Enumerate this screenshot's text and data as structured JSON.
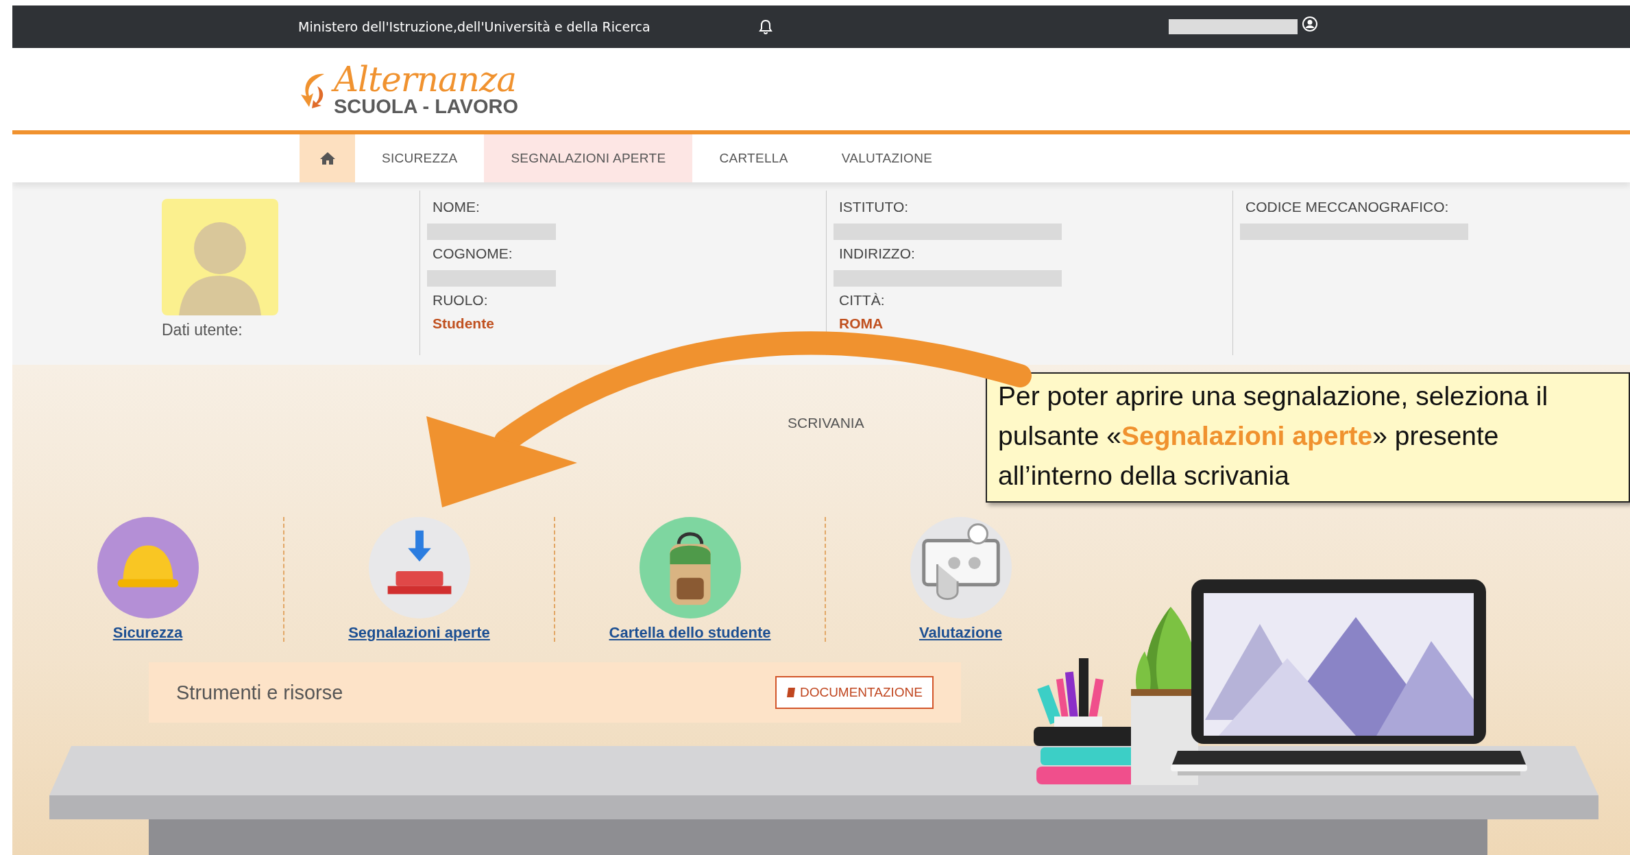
{
  "top_bar": {
    "ministry": "Ministero dell'Istruzione,dell'Università e della Ricerca"
  },
  "logo": {
    "title": "Alternanza",
    "subtitle": "SCUOLA - LAVORO"
  },
  "nav": {
    "tabs": [
      {
        "kind": "home",
        "selected": true,
        "highlighted": false
      },
      {
        "kind": "text",
        "label": "SICUREZZA",
        "selected": false,
        "highlighted": false
      },
      {
        "kind": "text",
        "label": "SEGNALAZIONI APERTE",
        "selected": false,
        "highlighted": true
      },
      {
        "kind": "text",
        "label": "CARTELLA",
        "selected": false,
        "highlighted": false
      },
      {
        "kind": "text",
        "label": "VALUTAZIONE",
        "selected": false,
        "highlighted": false
      }
    ]
  },
  "user_info": {
    "caption": "Dati utente:",
    "columns": [
      [
        {
          "label": "NOME:",
          "redacted": true
        },
        {
          "label": "COGNOME:",
          "redacted": true
        },
        {
          "label": "RUOLO:",
          "redacted": false,
          "value": "Studente"
        }
      ],
      [
        {
          "label": "ISTITUTO:",
          "redacted": true
        },
        {
          "label": "INDIRIZZO:",
          "redacted": true
        },
        {
          "label": "CITTÀ:",
          "redacted": false,
          "value": "ROMA"
        }
      ],
      [
        {
          "label": "CODICE MECCANOGRAFICO:",
          "redacted": true
        }
      ]
    ]
  },
  "desk": {
    "title": "SCRIVANIA",
    "shortcuts": [
      {
        "kind": "helmet",
        "label": "Sicurezza"
      },
      {
        "kind": "tray",
        "label": "Segnalazioni aperte"
      },
      {
        "kind": "backpack",
        "label": "Cartella dello studente"
      },
      {
        "kind": "touch",
        "label": "Valutazione"
      }
    ],
    "tools": {
      "title": "Strumenti e risorse",
      "button": "DOCUMENTAZIONE"
    }
  },
  "callout": {
    "text": "Per poter aprire una segnalazione, seleziona il pulsante «**Segnalazioni aperte**» presente all’interno della scrivania"
  }
}
